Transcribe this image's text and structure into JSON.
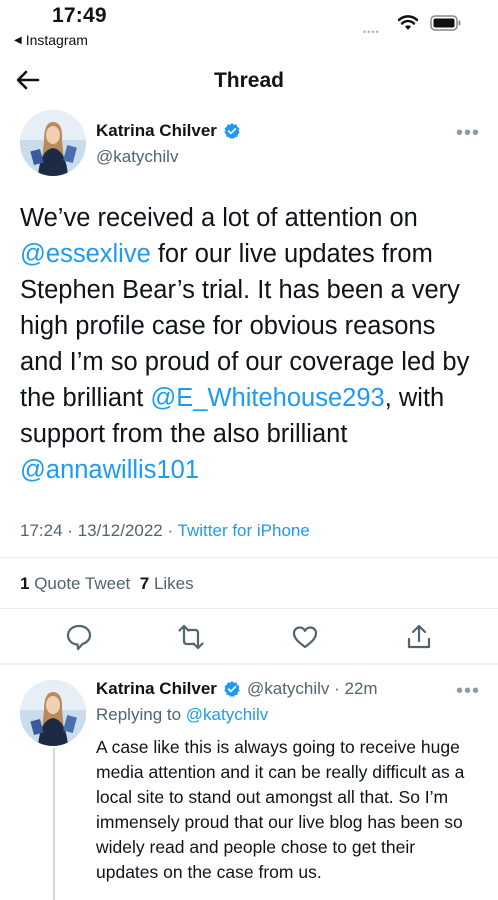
{
  "status_bar": {
    "time": "17:49",
    "back_app": "Instagram",
    "back_glyph": "◀"
  },
  "nav": {
    "title": "Thread"
  },
  "tweet": {
    "author_name": "Katrina Chilver",
    "handle": "@katychilv",
    "more": "•••",
    "text_parts": [
      "We’ve received a lot of attention on ",
      "@essexlive",
      " for our live updates from Stephen Bear’s trial. It has been a very high profile case for obvious reasons and I’m so proud of our coverage led by the brilliant ",
      "@E_Whitehouse293",
      ", with support from the also brilliant ",
      "@annawillis101"
    ],
    "timestamp": "17:24 · 13/12/2022 · ",
    "source": "Twitter for iPhone",
    "quote_count": "1",
    "quote_label": "Quote Tweet",
    "likes_count": "7",
    "likes_label": "Likes"
  },
  "reply": {
    "author_name": "Katrina Chilver",
    "handle_time": "@katychilv · 22m",
    "more": "•••",
    "replying_prefix": "Replying to ",
    "replying_handle": "@katychilv",
    "text": "A case like this is always going to receive huge media attention and it can be really difficult as a local site to stand out amongst all that. So I’m immensely proud that our live blog has been so widely read and people chose to get their updates on the case from us."
  },
  "colors": {
    "accent": "#1d9bf0",
    "text": "#0f1419",
    "muted": "#536471"
  },
  "icons": [
    "back-arrow-icon",
    "verified-badge-icon",
    "reply-icon",
    "retweet-icon",
    "like-icon",
    "share-icon",
    "wifi-icon",
    "battery-icon"
  ]
}
